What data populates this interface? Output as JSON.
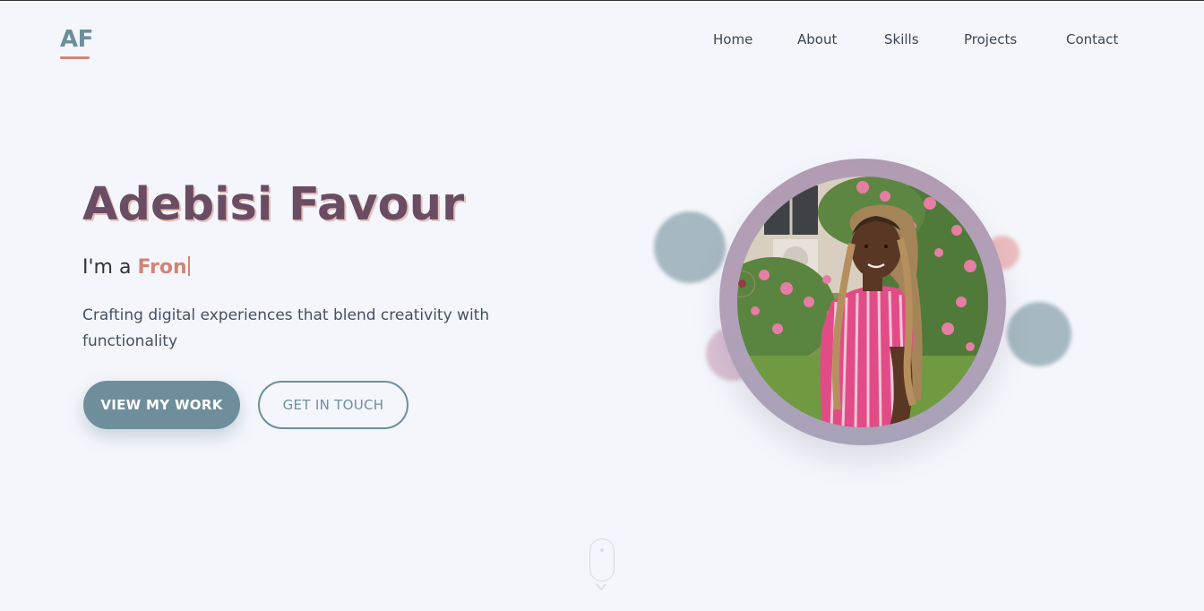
{
  "header": {
    "logo": "AF",
    "nav": [
      "Home",
      "About",
      "Skills",
      "Projects",
      "Contact"
    ]
  },
  "hero": {
    "name": "Adebisi Favour",
    "role_prefix": "I'm a ",
    "role_typed": "Fron",
    "tagline": "Crafting digital experiences that blend creativity with functionality",
    "primary_button": "VIEW MY WORK",
    "secondary_button": "GET IN TOUCH"
  },
  "colors": {
    "accent": "#6f8e9c",
    "highlight": "#d08576",
    "name": "#6a4d62",
    "background": "#f4f6fb"
  },
  "icons": {
    "scroll_indicator": "mouse-scroll-icon",
    "scroll_arrow": "chevron-down-icon"
  }
}
